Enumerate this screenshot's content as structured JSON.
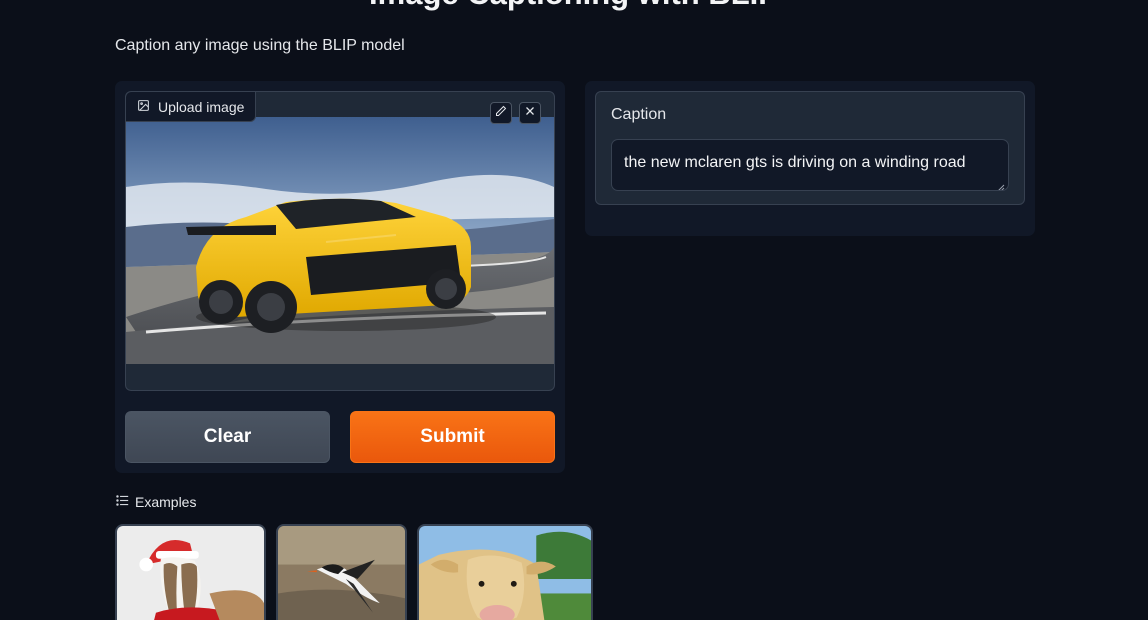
{
  "header": {
    "title": "Image Captioning with BLIP",
    "subtitle": "Caption any image using the BLIP model"
  },
  "input_panel": {
    "upload_label": "Upload image",
    "upload_icon": "image-icon",
    "edit_icon": "pencil-icon",
    "close_icon": "close-icon",
    "image_content": "yellow sports car on winding mountain road",
    "clear_label": "Clear",
    "submit_label": "Submit"
  },
  "output_panel": {
    "label": "Caption",
    "value": "the new mclaren gts is driving on a winding road"
  },
  "examples": {
    "label": "Examples",
    "icon": "list-icon",
    "items": [
      {
        "content": "greyhound dog in santa hat and red scarf"
      },
      {
        "content": "bird in flight over grass"
      },
      {
        "content": "cow standing in a field"
      }
    ]
  },
  "colors": {
    "background": "#0b0f19",
    "panel": "#111827",
    "submit": "#f97316",
    "clear": "#4b5563"
  }
}
